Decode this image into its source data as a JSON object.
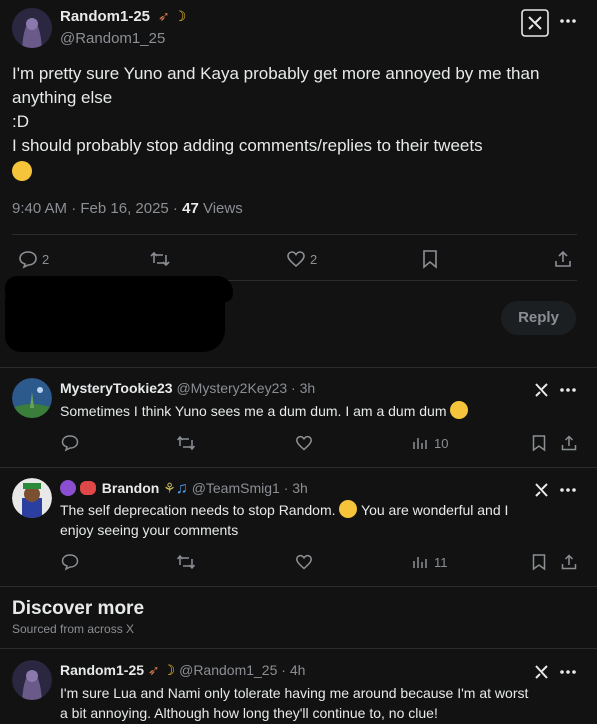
{
  "main_tweet": {
    "name": "Random1-25",
    "handle": "@Random1_25",
    "text_lines": [
      "I'm pretty sure Yuno and Kaya probably get more annoyed by me than",
      "anything else",
      ":D",
      "I should probably stop adding comments/replies to their tweets"
    ],
    "timestamp": "9:40 AM · Feb 16, 2025 · ",
    "views_count": "47",
    "views_label": " Views",
    "reply_count": "2",
    "like_count": "2"
  },
  "reply_box": {
    "button_label": "Reply"
  },
  "replies": [
    {
      "name": "MysteryTookie23",
      "handle": "@Mystery2Key23 · 3h",
      "text": "Sometimes I think Yuno sees me a dum dum. I am a dum dum",
      "views": "10"
    },
    {
      "name": "Brandon",
      "handle": "@TeamSmig1 · 3h",
      "text_line1": "The self deprecation needs to stop Random.",
      "text_line1b": " You are wonderful and I",
      "text_line2": "enjoy seeing your comments",
      "views": "11"
    }
  ],
  "discover": {
    "title": "Discover more",
    "subtitle": "Sourced from across X"
  },
  "discover_tweet": {
    "name": "Random1-25",
    "handle": "@Random1_25 · 4h",
    "text_line1": "I'm sure Lua and Nami only tolerate having me around because I'm at worst",
    "text_line2": "a bit annoying. Although how long they'll continue to, no clue!"
  },
  "colors": {
    "background": "#121212",
    "text": "#e7e9ea",
    "muted": "#8b8f94"
  }
}
